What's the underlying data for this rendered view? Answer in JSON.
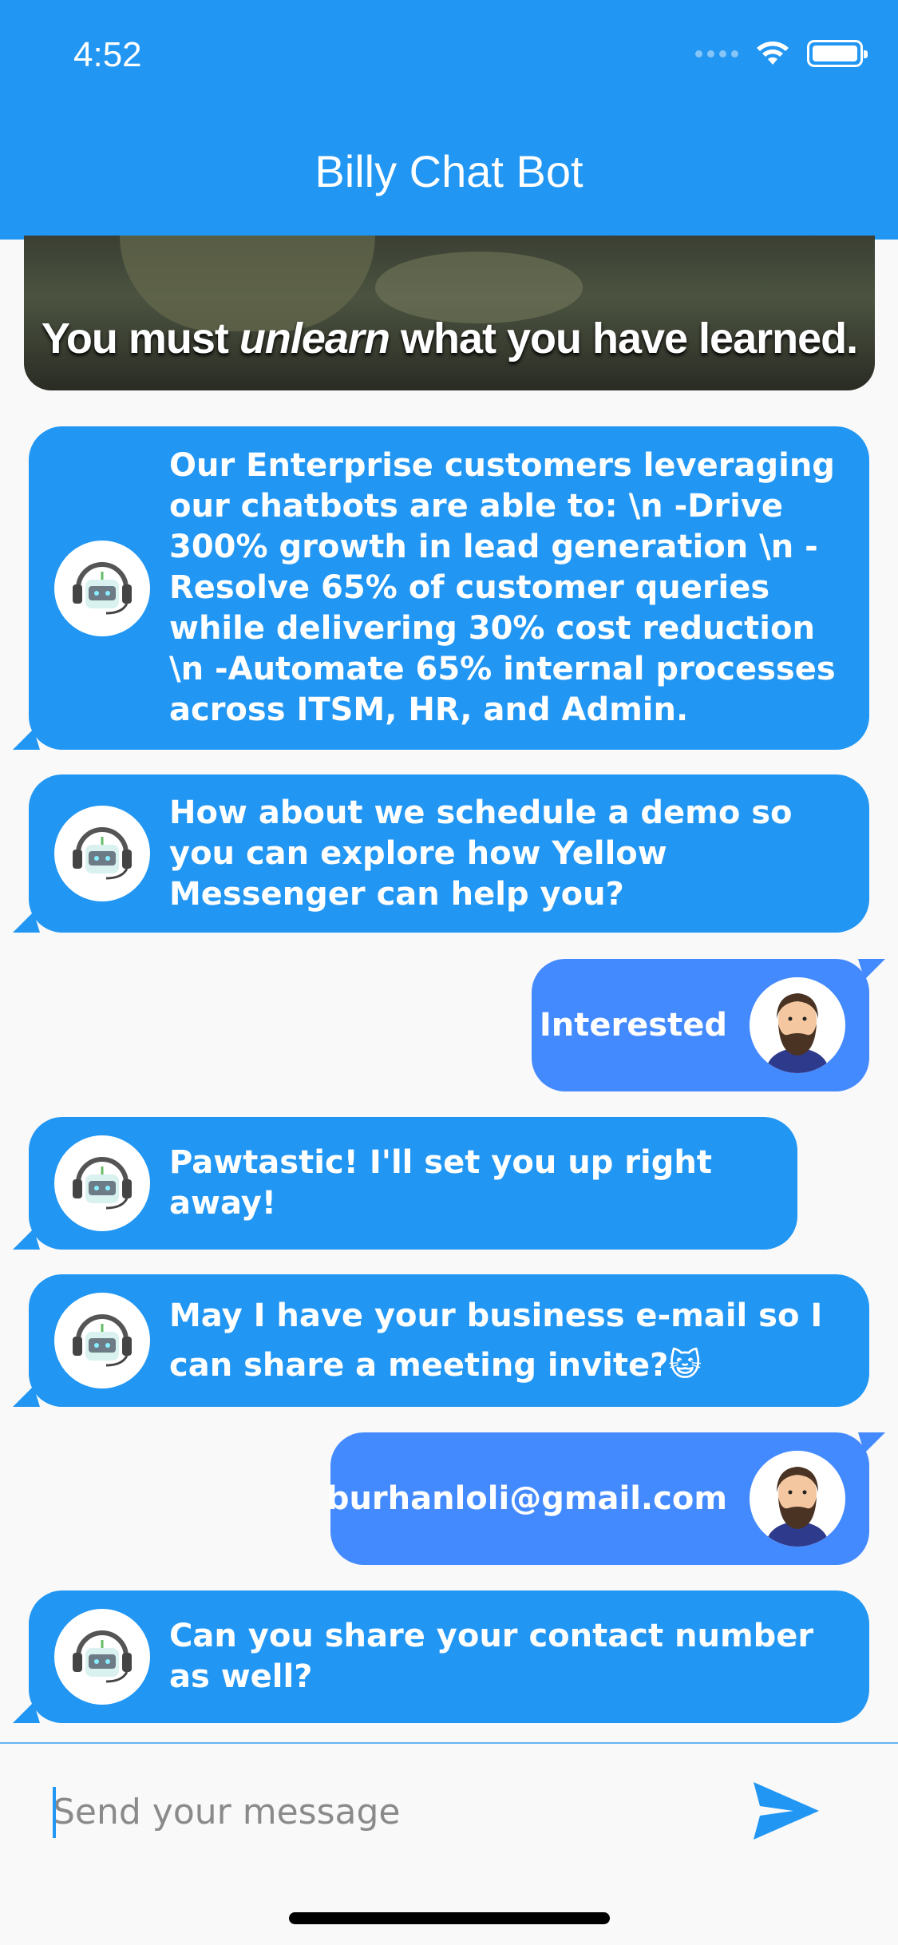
{
  "status_bar": {
    "time": "4:52"
  },
  "header": {
    "title": "Billy Chat Bot"
  },
  "gif": {
    "caption_before": "You must ",
    "caption_emph": "unlearn",
    "caption_after": " what you have learned."
  },
  "messages": [
    {
      "sender": "bot",
      "text": "Our Enterprise customers leveraging our chatbots are able to: \\n -Drive 300% growth in lead generation \\n -Resolve 65% of customer queries while delivering 30% cost reduction \\n -Automate 65% internal processes across ITSM, HR, and Admin."
    },
    {
      "sender": "bot",
      "text": "How about we schedule a demo so you can explore how Yellow Messenger can help you?"
    },
    {
      "sender": "user",
      "text": "Interested"
    },
    {
      "sender": "bot",
      "text": "Pawtastic! I'll set you up right away!"
    },
    {
      "sender": "bot",
      "text": "May I have your business e-mail so I can share a meeting invite?😺"
    },
    {
      "sender": "user",
      "text": "burhanloli@gmail.com"
    },
    {
      "sender": "bot",
      "text": "Can you share your contact number as well?"
    }
  ],
  "composer": {
    "placeholder": "Send your message"
  },
  "colors": {
    "header": "#2196f3",
    "bot_bubble": "#2196f3",
    "user_bubble": "#448aff"
  },
  "icons": {
    "send": "send-icon",
    "bot_avatar": "robot-headset-avatar",
    "user_avatar": "bearded-man-avatar"
  }
}
